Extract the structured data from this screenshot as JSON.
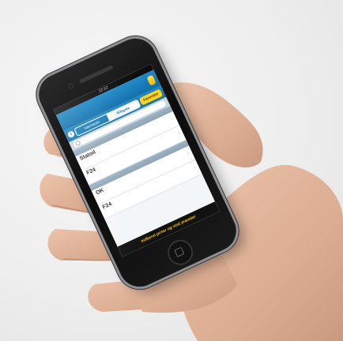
{
  "scene": {
    "description_icons": [
      "hand-illustration",
      "smartphone"
    ],
    "colors": {
      "skin": "#e0b49a",
      "skin_shadow": "#c4907a",
      "nav_blue": "#1572ab",
      "accent_yellow": "#f5c400"
    }
  },
  "phone": {
    "status": {
      "carrier": "",
      "time": "12:12",
      "battery": ""
    },
    "nav": {
      "title": "",
      "date": "",
      "right_button": ""
    },
    "segments": {
      "info_icon": "i",
      "items": [
        "Nærmeste",
        "Billigste"
      ],
      "active_index": 1,
      "yellow_button": "Favoritter"
    },
    "search": {
      "placeholder": ""
    },
    "sections": [
      {
        "header": "",
        "rows": [
          {
            "name": "Statoil",
            "sub": "",
            "price": "",
            "star_icon": "star-icon"
          },
          {
            "name": "F24",
            "sub": "",
            "price": "",
            "star_icon": "star-icon"
          }
        ]
      },
      {
        "header": "",
        "rows": [
          {
            "name": "OK",
            "sub": "",
            "price": "",
            "star_icon": "star-icon"
          },
          {
            "name": "F24",
            "sub": "",
            "price": "",
            "star_icon": "star-icon"
          }
        ]
      }
    ],
    "bottom_bar": "Indberet priser og vind præmier"
  }
}
